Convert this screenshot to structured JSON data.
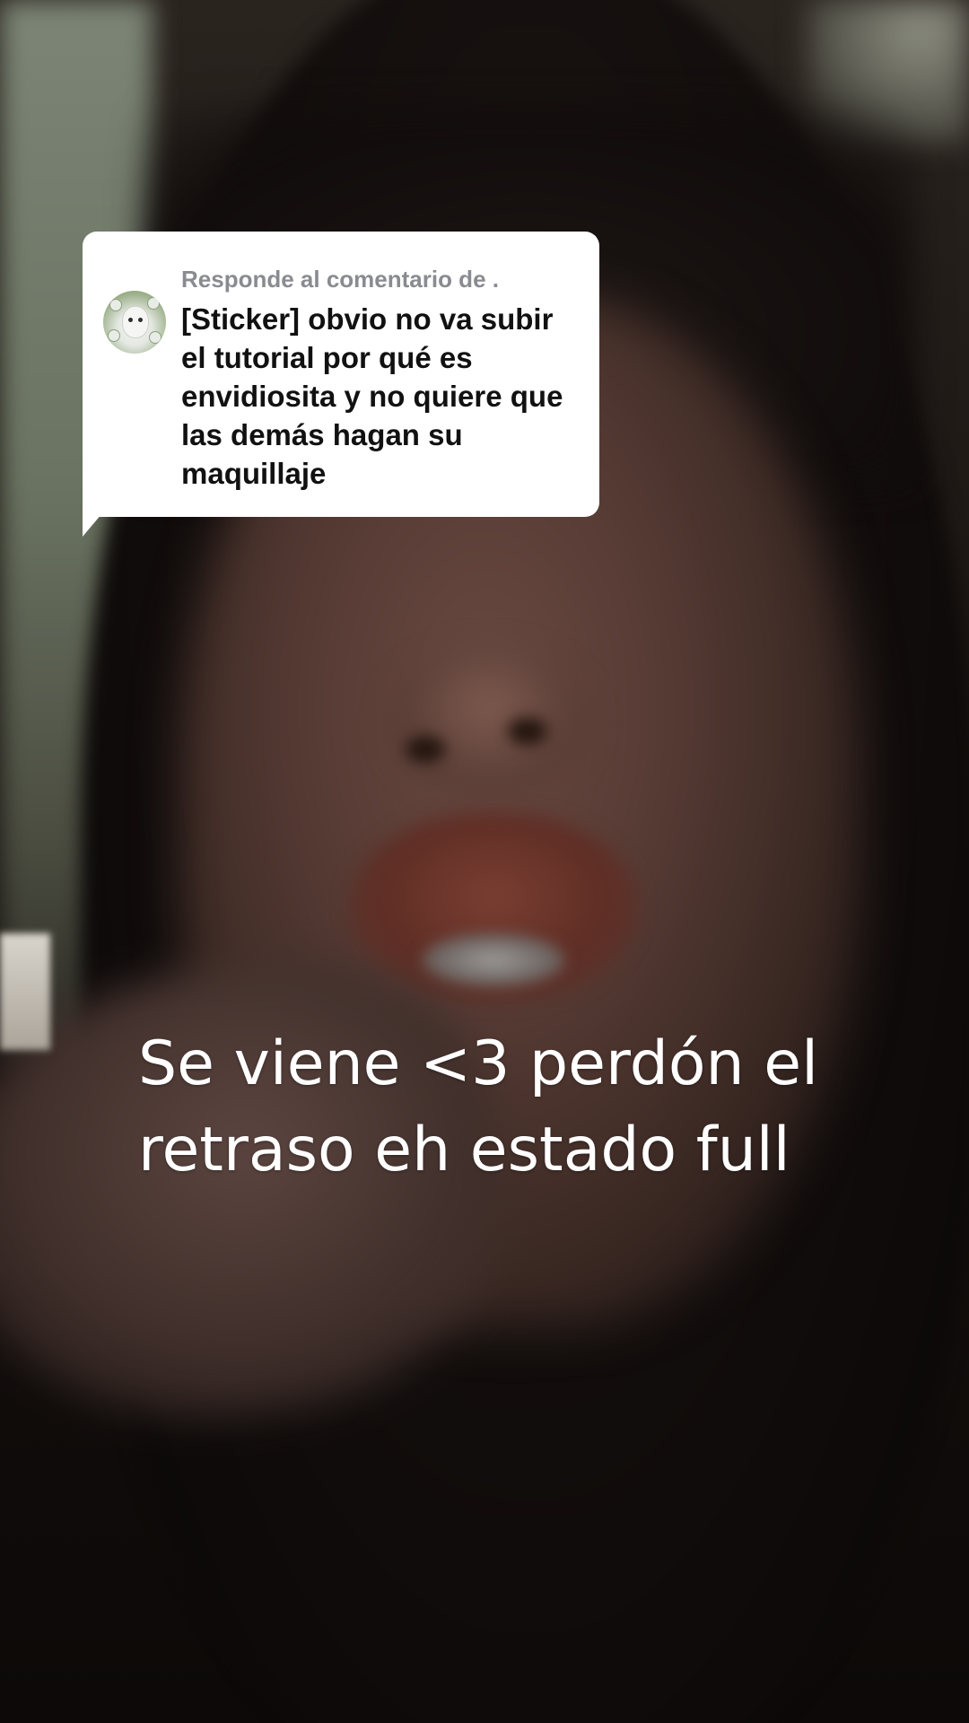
{
  "reply_bubble": {
    "header": "Responde al comentario de .",
    "comment_text": "[Sticker] obvio no va subir el tutorial por qué es envidiosita y no quiere que las demás hagan su maquillaje",
    "avatar_icon": "cat-sticker-avatar"
  },
  "caption": {
    "line1": "Se viene <3 perdón el",
    "line2": "retraso eh estado full"
  },
  "colors": {
    "bubble_bg": "#ffffff",
    "bubble_header": "#8a8b91",
    "bubble_text": "#111111",
    "caption_text": "#ffffff"
  }
}
